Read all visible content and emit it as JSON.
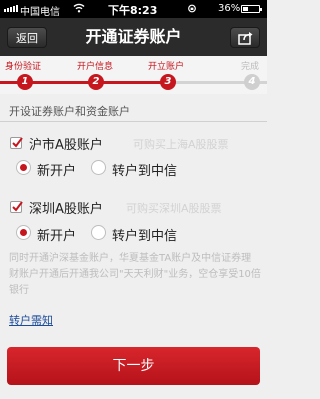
{
  "status_bar": {
    "carrier": "中国电信",
    "time": "下午8:23",
    "battery": "36%"
  },
  "header": {
    "back_label": "返回",
    "title": "开通证券账户"
  },
  "steps": [
    {
      "label": "身份验证",
      "number": "1",
      "state": "done"
    },
    {
      "label": "开户信息",
      "number": "2",
      "state": "done"
    },
    {
      "label": "开立账户",
      "number": "3",
      "state": "current"
    },
    {
      "label": "完成",
      "number": "4",
      "state": "pending"
    }
  ],
  "section_title": "开设证券账户和资金账户",
  "shanghai": {
    "label": "沪市A股账户",
    "hint": "可购买上海A股股票",
    "checked": true,
    "options": [
      {
        "label": "新开户",
        "selected": true
      },
      {
        "label": "转户到中信",
        "selected": false
      }
    ]
  },
  "shenzhen": {
    "label": "深圳A股账户",
    "hint": "可购买深圳A股股票",
    "checked": true,
    "options": [
      {
        "label": "新开户",
        "selected": true
      },
      {
        "label": "转户到中信",
        "selected": false
      }
    ]
  },
  "description": "同时开通沪深基金账户，华夏基金TA账户及中信证券理财账户开通后开通我公司\"天天利财\"业务，空仓享受10倍银行",
  "transfer_link": "转户需知",
  "next_button": "下一步",
  "colors": {
    "accent": "#c6161e",
    "header": "#2b2b2b",
    "background": "#efefef"
  }
}
